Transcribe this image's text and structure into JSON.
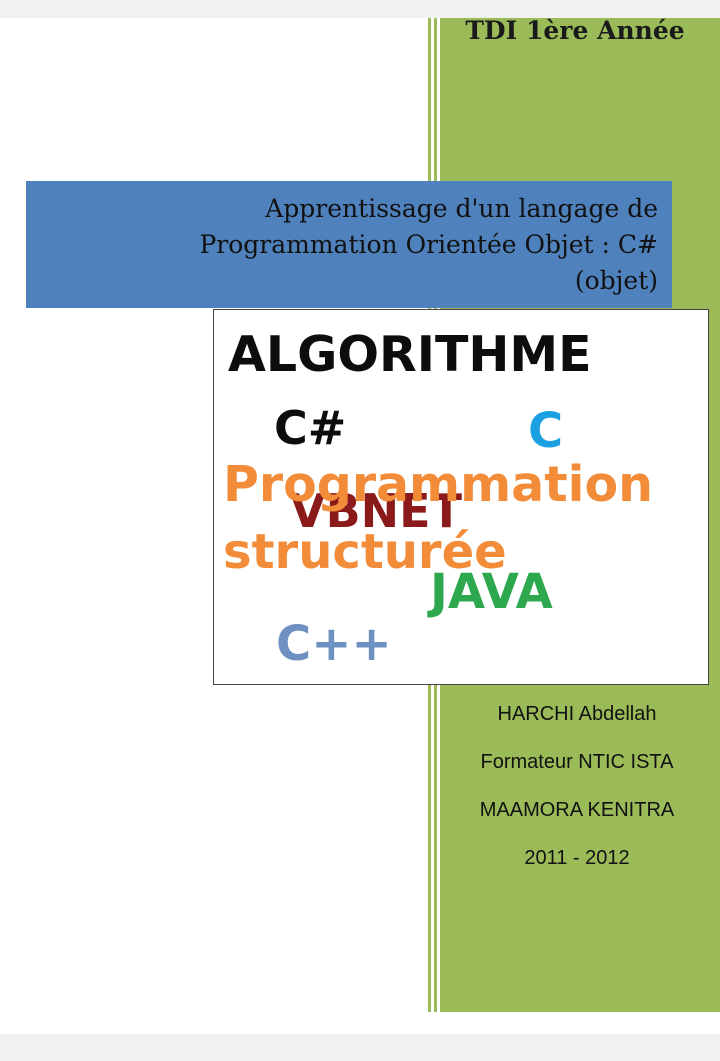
{
  "header": {
    "year_label": "TDI 1ère Année"
  },
  "title": {
    "line1": "Apprentissage d'un langage de",
    "line2": "Programmation Orientée Objet : C#",
    "line3": "(objet)"
  },
  "cover_image_words": {
    "algorithme": "ALGORITHME",
    "csharp": "C#",
    "c": "C",
    "programmation": "Programmation",
    "vbnet": "VBNET",
    "structuree": "structurée",
    "java": "JAVA",
    "cpp": "C++"
  },
  "author": {
    "name": "HARCHI Abdellah",
    "role": "Formateur NTIC ISTA",
    "location": "MAAMORA KENITRA",
    "years": "2011 - 2012"
  },
  "colors": {
    "green_column": "#9bbb59",
    "title_banner": "#4f81bd",
    "c_blue": "#1ba1e2",
    "programmation_orange": "#f28c38",
    "vbnet_red": "#8b1a1a",
    "java_green": "#2ea84f",
    "cpp_blue": "#6f91c1"
  }
}
